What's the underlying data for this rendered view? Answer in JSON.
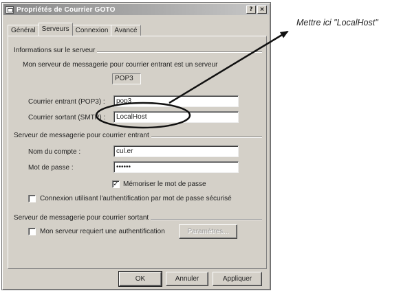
{
  "window": {
    "title": "Propriétés de Courrier GOTO",
    "help_btn": "?",
    "close_btn": "×"
  },
  "tabs": [
    {
      "label": "Général",
      "active": false
    },
    {
      "label": "Serveurs",
      "active": true
    },
    {
      "label": "Connexion",
      "active": false
    },
    {
      "label": "Avancé",
      "active": false
    }
  ],
  "server_info": {
    "group_title": "Informations sur le serveur",
    "description": "Mon serveur de messagerie pour courrier entrant est un serveur",
    "server_type": "POP3",
    "incoming_label": "Courrier entrant (POP3) :",
    "incoming_value": "pop3",
    "outgoing_label": "Courrier sortant (SMTP) :",
    "outgoing_value": "LocalHost"
  },
  "incoming_server": {
    "group_title": "Serveur de messagerie pour courrier entrant",
    "account_label": "Nom du compte :",
    "account_value": "cul.er",
    "password_label": "Mot de passe :",
    "password_value": "••••••",
    "remember_label": "Mémoriser le mot de passe",
    "remember_checked": true,
    "spa_label": "Connexion utilisant l'authentification par mot de passe sécurisé",
    "spa_checked": false
  },
  "outgoing_server": {
    "group_title": "Serveur de messagerie pour courrier sortant",
    "auth_label": "Mon serveur requiert une authentification",
    "auth_checked": false,
    "settings_button": "Paramètres..."
  },
  "footer": {
    "ok": "OK",
    "cancel": "Annuler",
    "apply": "Appliquer"
  },
  "annotation": {
    "text": "Mettre ici \"LocalHost\""
  },
  "colors": {
    "dialog_face": "#d4d0c8",
    "titlebar": "#9a9a9a",
    "annotation_stroke": "#111111"
  },
  "icons": {
    "check": "✓"
  }
}
